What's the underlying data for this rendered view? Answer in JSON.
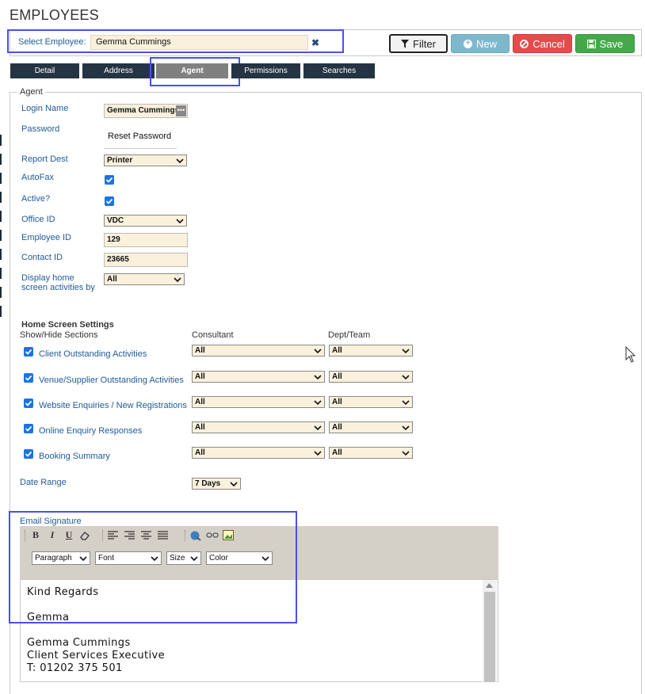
{
  "page": {
    "title": "EMPLOYEES"
  },
  "select_employee": {
    "label": "Select Employee:",
    "value": "Gemma Cummings",
    "clear": "✖"
  },
  "toolbar": {
    "filter": "Filter",
    "new": "New",
    "cancel": "Cancel",
    "save": "Save"
  },
  "tabs": [
    {
      "label": "Detail"
    },
    {
      "label": "Address"
    },
    {
      "label": "Agent"
    },
    {
      "label": "Permissions"
    },
    {
      "label": "Searches"
    }
  ],
  "agent": {
    "legend": "Agent",
    "login_name": {
      "label": "Login Name",
      "value": "Gemma Cummings"
    },
    "password": {
      "label": "Password",
      "reset": "Reset Password"
    },
    "report_dest": {
      "label": "Report Dest",
      "value": "Printer"
    },
    "autofax": {
      "label": "AutoFax",
      "checked": true
    },
    "active": {
      "label": "Active?",
      "checked": true
    },
    "office_id": {
      "label": "Office ID",
      "value": "VDC"
    },
    "employee_id": {
      "label": "Employee ID",
      "value": "129"
    },
    "contact_id": {
      "label": "Contact ID",
      "value": "23665"
    },
    "display_by": {
      "label_1": "Display home",
      "label_2": "screen activities by",
      "value": "All"
    }
  },
  "home_screen": {
    "title": "Home Screen Settings",
    "show_hide": "Show/Hide Sections",
    "col_consultant": "Consultant",
    "col_dept": "Dept/Team",
    "rows": [
      {
        "label": "Client Outstanding Activities",
        "consultant": "All",
        "dept": "All"
      },
      {
        "label": "Venue/Supplier Outstanding Activities",
        "consultant": "All",
        "dept": "All"
      },
      {
        "label": "Website Enquiries / New Registrations",
        "consultant": "All",
        "dept": "All"
      },
      {
        "label": "Online Enquiry Responses",
        "consultant": "All",
        "dept": "All"
      },
      {
        "label": "Booking Summary",
        "consultant": "All",
        "dept": "All"
      }
    ],
    "date_range": {
      "label": "Date Range",
      "value": "7 Days"
    }
  },
  "signature": {
    "label": "Email Signature",
    "paragraph": "Paragraph",
    "font": "Font",
    "size": "Size",
    "color": "Color",
    "lines": [
      "Kind Regards",
      "Gemma",
      "Gemma Cummings",
      "Client Services Executive",
      "T: 01202 375 501"
    ]
  },
  "colors": {
    "tab_dark": "#253444",
    "highlight": "#4a4ff0",
    "label_blue": "#1f5a9a",
    "field_bg": "#faf1dc"
  }
}
